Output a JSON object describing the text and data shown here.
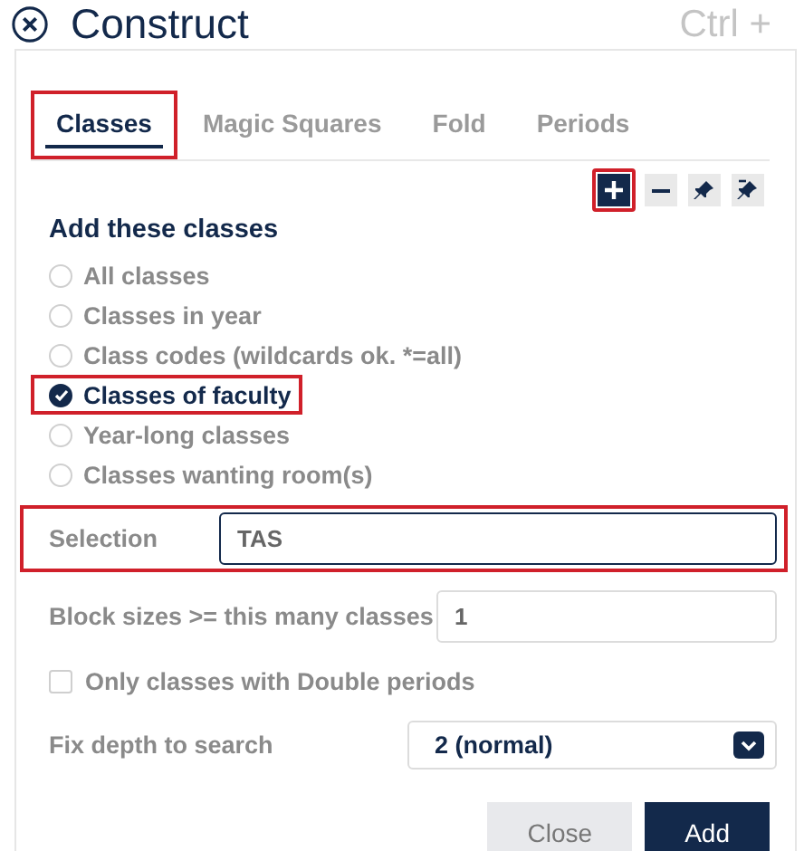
{
  "header": {
    "title": "Construct",
    "shortcut": "Ctrl +"
  },
  "tabs": [
    {
      "label": "Classes",
      "selected": true,
      "highlighted": true
    },
    {
      "label": "Magic Squares",
      "selected": false
    },
    {
      "label": "Fold",
      "selected": false
    },
    {
      "label": "Periods",
      "selected": false
    }
  ],
  "toolbar": [
    {
      "kind": "plus",
      "selected": true,
      "highlighted": true
    },
    {
      "kind": "minus",
      "selected": false
    },
    {
      "kind": "pin",
      "selected": false
    },
    {
      "kind": "unpin",
      "selected": false
    }
  ],
  "section_title": "Add these classes",
  "options": [
    {
      "label": "All classes",
      "selected": false
    },
    {
      "label": "Classes in year",
      "selected": false
    },
    {
      "label": "Class codes (wildcards ok. *=all)",
      "selected": false
    },
    {
      "label": "Classes of faculty",
      "selected": true,
      "highlighted": true
    },
    {
      "label": "Year-long classes",
      "selected": false
    },
    {
      "label": "Classes wanting room(s)",
      "selected": false
    }
  ],
  "selection": {
    "label": "Selection",
    "value": "TAS",
    "highlighted": true
  },
  "block_sizes": {
    "label": "Block sizes >= this many classes",
    "value": "1"
  },
  "double_periods": {
    "label": "Only classes with Double periods",
    "checked": false
  },
  "fix_depth": {
    "label": "Fix depth to search",
    "value": "2 (normal)"
  },
  "buttons": [
    {
      "label": "Close",
      "kind": "secondary"
    },
    {
      "label": "Add",
      "kind": "primary"
    }
  ]
}
